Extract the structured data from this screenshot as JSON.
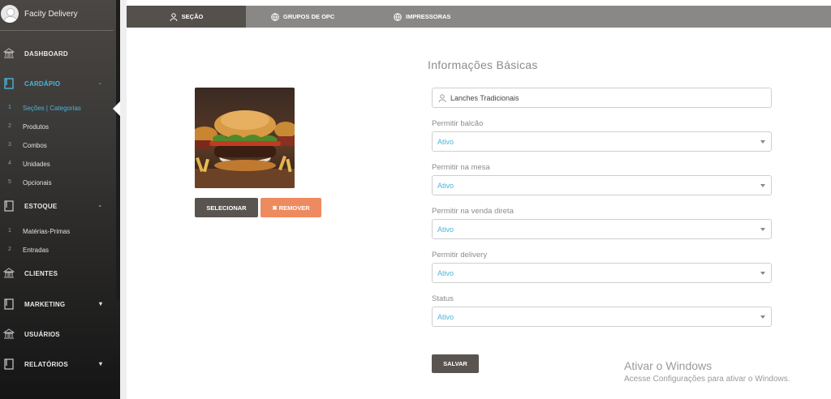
{
  "profile": {
    "name": "Facity Delivery"
  },
  "sidebar": {
    "main": [
      {
        "label": "DASHBOARD",
        "icon": "bank-icon"
      },
      {
        "label": "CARDÁPIO",
        "icon": "book-icon"
      },
      {
        "label": "ESTOQUE",
        "icon": "book-icon"
      },
      {
        "label": "CLIENTES",
        "icon": "bank-icon"
      },
      {
        "label": "MARKETING",
        "icon": "book-icon"
      },
      {
        "label": "USUÁRIOS",
        "icon": "bank-icon"
      },
      {
        "label": "RELATÓRIOS",
        "icon": "book-icon"
      }
    ],
    "cardapio_items": [
      {
        "num": "1",
        "label": "Seções | Categorias"
      },
      {
        "num": "2",
        "label": "Produtos"
      },
      {
        "num": "3",
        "label": "Combos"
      },
      {
        "num": "4",
        "label": "Unidades"
      },
      {
        "num": "5",
        "label": "Opcionais"
      }
    ],
    "estoque_items": [
      {
        "num": "1",
        "label": "Matérias-Primas"
      },
      {
        "num": "2",
        "label": "Entradas"
      }
    ],
    "caret": "-",
    "caret_collapsed": "▾"
  },
  "tabs": [
    {
      "label": "SEÇÃO",
      "icon": "user-icon"
    },
    {
      "label": "GRUPOS DE OPC",
      "icon": "globe-icon"
    },
    {
      "label": "IMPRESSORAS",
      "icon": "globe-icon"
    }
  ],
  "image_buttons": {
    "select": "SELECIONAR",
    "remove": "✖ REMOVER"
  },
  "form": {
    "title": "Informações Básicas",
    "name_value": "Lanches Tradicionais",
    "fields": [
      {
        "label": "Permitir balcão",
        "value": "Ativo"
      },
      {
        "label": "Permitir na mesa",
        "value": "Ativo"
      },
      {
        "label": "Permitir na venda direta",
        "value": "Ativo"
      },
      {
        "label": "Permitir delivery",
        "value": "Ativo"
      },
      {
        "label": "Status",
        "value": "Ativo"
      }
    ],
    "save": "SALVAR"
  },
  "watermark": {
    "title": "Ativar o Windows",
    "subtitle": "Acesse Configurações para ativar o Windows."
  },
  "colors": {
    "accent": "#4ab5d8",
    "sidebar_dark": "#3a3836",
    "remove": "#ee8a5f",
    "button_dark": "#5a5450"
  }
}
